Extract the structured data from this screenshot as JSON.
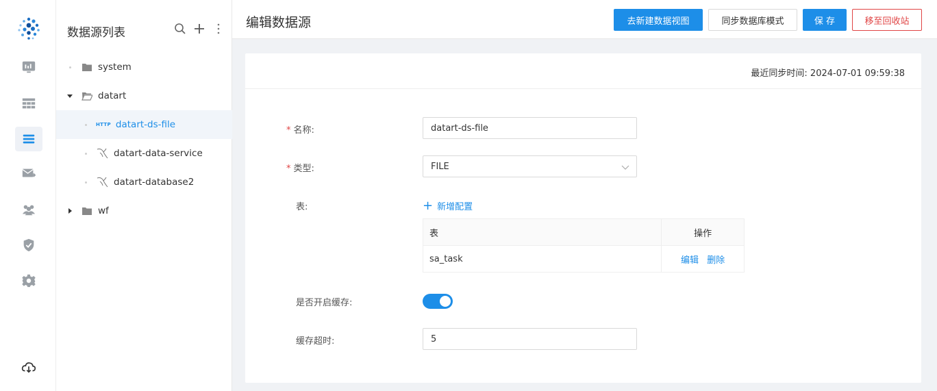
{
  "sidebar": {
    "items": [
      {
        "name": "dashboard-icon",
        "active": false
      },
      {
        "name": "dataview-icon",
        "active": false
      },
      {
        "name": "datasource-icon",
        "active": true
      },
      {
        "name": "schedule-icon",
        "active": false
      },
      {
        "name": "members-icon",
        "active": false
      },
      {
        "name": "permission-icon",
        "active": false
      },
      {
        "name": "settings-icon",
        "active": false
      },
      {
        "name": "download-icon",
        "active": false
      }
    ]
  },
  "tree": {
    "title": "数据源列表",
    "nodes": [
      {
        "label": "system",
        "type": "folder",
        "expanded": false,
        "level": 0
      },
      {
        "label": "datart",
        "type": "folder",
        "expanded": true,
        "level": 0
      },
      {
        "label": "datart-ds-file",
        "type": "http",
        "selected": true,
        "level": 1,
        "badge": "HTTP"
      },
      {
        "label": "datart-data-service",
        "type": "mysql",
        "level": 1
      },
      {
        "label": "datart-database2",
        "type": "mysql",
        "level": 1
      },
      {
        "label": "wf",
        "type": "folder",
        "expanded": false,
        "level": 0
      }
    ]
  },
  "header": {
    "title": "编辑数据源",
    "new_view_button": "去新建数据视图",
    "sync_button": "同步数据库模式",
    "save_button": "保 存",
    "recycle_button": "移至回收站"
  },
  "card": {
    "sync_time": "最近同步时间: 2024-07-01 09:59:38"
  },
  "form": {
    "name_label": "名称:",
    "name_value": "datart-ds-file",
    "type_label": "类型:",
    "type_value": "FILE",
    "table_label": "表:",
    "add_config": "新增配置",
    "table": {
      "headers": [
        "表",
        "操作"
      ],
      "rows": [
        {
          "name": "sa_task",
          "edit": "编辑",
          "delete": "删除"
        }
      ]
    },
    "cache_label": "是否开启缓存:",
    "cache_enabled": true,
    "cache_timeout_label": "缓存超时:",
    "cache_timeout_value": "5"
  },
  "colors": {
    "primary": "#1d8ee8",
    "danger": "#e04444"
  }
}
